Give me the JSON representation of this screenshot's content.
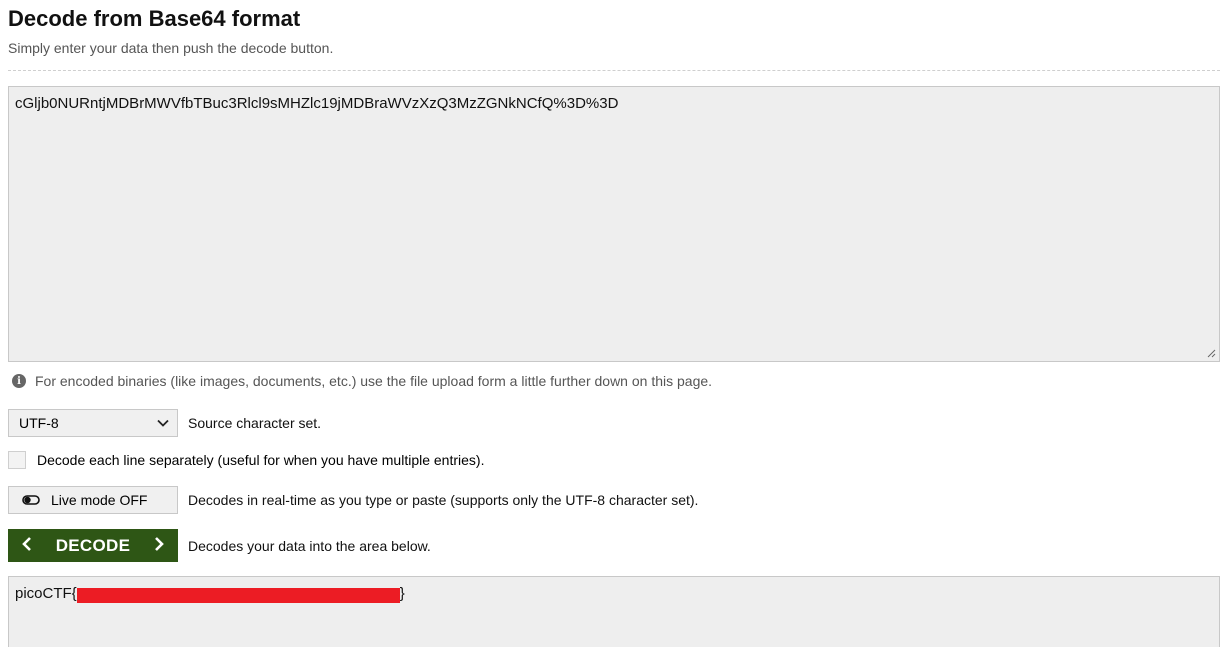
{
  "header": {
    "title": "Decode from Base64 format",
    "subtitle": "Simply enter your data then push the decode button."
  },
  "input": {
    "value": "cGljb0NURntjMDBrMWVfbTBuc3Rlcl9sMHZlc19jMDBraWVzXzQ3MzZGNkNCfQ%3D%3D"
  },
  "info": {
    "icon": "info-icon",
    "text": "For encoded binaries (like images, documents, etc.) use the file upload form a little further down on this page."
  },
  "charset": {
    "selected": "UTF-8",
    "label": "Source character set."
  },
  "options": {
    "line_by_line_label": "Decode each line separately (useful for when you have multiple entries).",
    "line_by_line_checked": false
  },
  "live_mode": {
    "button_label": "Live mode OFF",
    "description": "Decodes in real-time as you type or paste (supports only the UTF-8 character set)."
  },
  "decode": {
    "button_label": "DECODE",
    "description": "Decodes your data into the area below."
  },
  "output": {
    "prefix": "picoCTF{",
    "suffix": "}",
    "redaction_color": "#ec1c24"
  },
  "colors": {
    "decode_button_bg": "#2e5615",
    "field_bg": "#eeeeee"
  }
}
